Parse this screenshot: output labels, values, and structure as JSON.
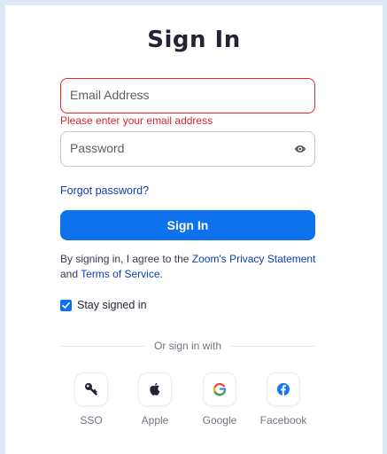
{
  "title": "Sign In",
  "email": {
    "placeholder": "Email Address",
    "value": "",
    "error": "Please enter your email address"
  },
  "password": {
    "placeholder": "Password",
    "value": ""
  },
  "forgot_label": "Forgot password?",
  "signin_label": "Sign In",
  "agreement": {
    "prefix": "By signing in, I agree to the ",
    "privacy_link": "Zoom's Privacy Statement",
    "middle": " and ",
    "terms_link": "Terms of Service",
    "suffix": "."
  },
  "stay_signed_in": {
    "label": "Stay signed in",
    "checked": true
  },
  "divider_label": "Or sign in with",
  "social": [
    {
      "label": "SSO",
      "icon": "key-icon"
    },
    {
      "label": "Apple",
      "icon": "apple-icon"
    },
    {
      "label": "Google",
      "icon": "google-icon"
    },
    {
      "label": "Facebook",
      "icon": "facebook-icon"
    }
  ],
  "colors": {
    "accent": "#0e72ed",
    "link": "#0e3eb3",
    "error": "#d5242d",
    "background": "#dfe8f5"
  }
}
